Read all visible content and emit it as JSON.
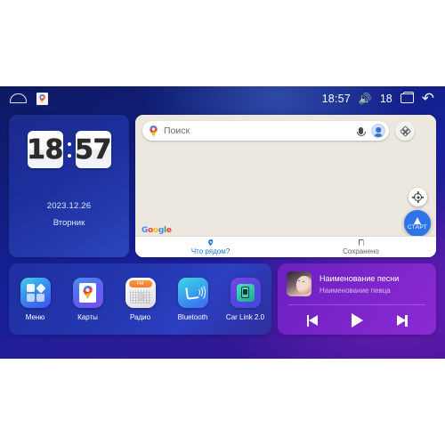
{
  "statusbar": {
    "home_icon": "home-icon",
    "notification_icon": "google-maps-notification-icon",
    "time": "18:57",
    "volume_icon": "volume-icon",
    "volume_level": "18",
    "recents_icon": "recents-icon",
    "back_icon": "back-icon"
  },
  "clock_widget": {
    "hours": "18",
    "minutes": "57",
    "date": "2023.12.26",
    "weekday": "Вторник"
  },
  "map_widget": {
    "search": {
      "placeholder": "Поиск",
      "pin_icon": "google-maps-pin-icon",
      "mic_icon": "microphone-icon",
      "avatar_icon": "account-avatar-icon"
    },
    "settings_icon": "map-layers-icon",
    "locate_icon": "my-location-icon",
    "start_button_label": "СТАРТ",
    "brand": [
      "G",
      "o",
      "o",
      "g",
      "l",
      "e"
    ],
    "tabs": [
      {
        "label": "Что рядом?",
        "icon": "pin-icon",
        "active": true
      },
      {
        "label": "Сохранено",
        "icon": "bookmark-icon",
        "active": false
      }
    ]
  },
  "apps": [
    {
      "label": "Меню",
      "icon": "menu-grid-icon"
    },
    {
      "label": "Карты",
      "icon": "maps-icon"
    },
    {
      "label": "Радио",
      "icon": "radio-icon",
      "band": "FM"
    },
    {
      "label": "Bluetooth",
      "icon": "bluetooth-phone-icon"
    },
    {
      "label": "Car Link 2.0",
      "icon": "car-link-icon"
    }
  ],
  "music_widget": {
    "album_art": "album-art",
    "title": "Наименование песни",
    "artist": "Наименование певца",
    "controls": [
      {
        "name": "previous",
        "icon": "skip-previous-icon"
      },
      {
        "name": "play",
        "icon": "play-icon"
      },
      {
        "name": "next",
        "icon": "skip-next-icon"
      }
    ]
  },
  "colors": {
    "bg_blue": "#16219a",
    "bg_purple": "#3a0f8e",
    "accent_blue": "#1a73e8",
    "music_purple": "#7a25c9",
    "map_bg": "#ece8e0"
  }
}
